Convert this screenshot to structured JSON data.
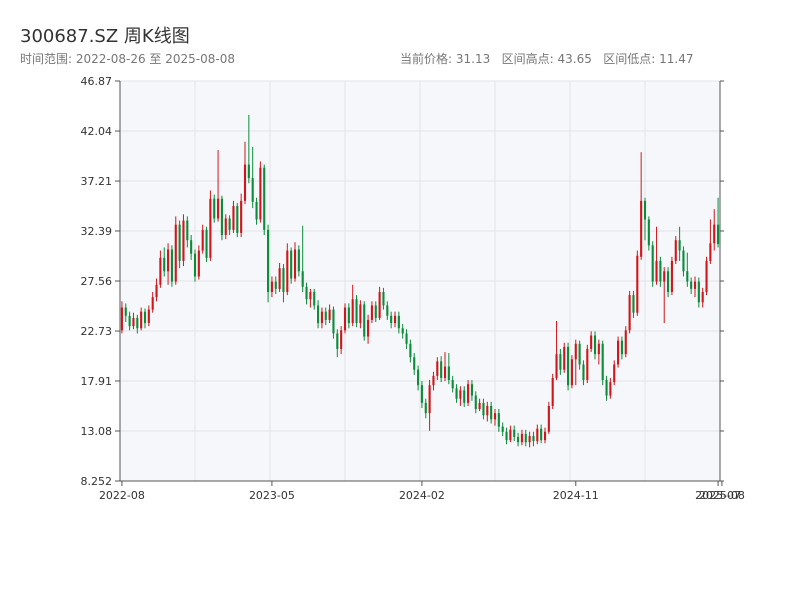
{
  "header": {
    "title": "300687.SZ 周K线图",
    "range_text": "时间范围: 2022-08-26 至 2025-08-08",
    "stats_text": "当前价格: 31.13   区间高点: 43.65   区间低点: 11.47"
  },
  "colors": {
    "up": "#d0161b",
    "down": "#0a8c39",
    "plot_bg": "#f6f7fa",
    "grid": "#e1e3e8",
    "axis": "#555555"
  },
  "chart_data": {
    "type": "candlestick",
    "title": "300687.SZ 周K线图",
    "xlabel": "",
    "ylabel": "",
    "ylim": [
      8.252,
      46.87
    ],
    "y_ticks": [
      "8.252",
      "13.08",
      "17.91",
      "22.73",
      "27.56",
      "32.39",
      "37.21",
      "42.04",
      "46.87"
    ],
    "x_ticks": [
      "2022-08",
      "2023-05",
      "2024-02",
      "2024-11",
      "2025-07",
      "2025-08"
    ],
    "x_tick_index": [
      0,
      39,
      78,
      118,
      155,
      156
    ],
    "grid": true,
    "candles": [
      [
        22.8,
        25.0,
        25.6,
        22.5
      ],
      [
        25.0,
        24.2,
        25.4,
        23.6
      ],
      [
        24.2,
        23.2,
        24.6,
        22.8
      ],
      [
        23.2,
        24.0,
        24.5,
        22.9
      ],
      [
        24.0,
        23.0,
        24.3,
        22.5
      ],
      [
        23.0,
        24.6,
        25.0,
        22.8
      ],
      [
        24.6,
        23.5,
        24.9,
        23.0
      ],
      [
        23.5,
        24.8,
        25.2,
        23.2
      ],
      [
        24.8,
        26.0,
        26.5,
        24.5
      ],
      [
        26.0,
        27.2,
        27.8,
        25.6
      ],
      [
        27.2,
        29.8,
        30.5,
        26.9
      ],
      [
        29.8,
        28.5,
        30.8,
        28.0
      ],
      [
        28.5,
        30.6,
        31.2,
        27.2
      ],
      [
        30.6,
        27.5,
        31.0,
        27.0
      ],
      [
        27.5,
        33.0,
        33.8,
        27.2
      ],
      [
        33.0,
        29.5,
        33.4,
        28.8
      ],
      [
        29.5,
        33.4,
        34.0,
        29.0
      ],
      [
        33.4,
        31.5,
        33.8,
        30.8
      ],
      [
        31.5,
        30.2,
        32.0,
        29.6
      ],
      [
        30.2,
        28.0,
        30.6,
        27.5
      ],
      [
        28.0,
        30.5,
        31.0,
        27.7
      ],
      [
        30.5,
        32.5,
        33.0,
        30.2
      ],
      [
        32.5,
        29.8,
        32.8,
        29.4
      ],
      [
        29.8,
        35.5,
        36.3,
        29.5
      ],
      [
        35.5,
        33.6,
        35.9,
        33.2
      ],
      [
        33.6,
        35.5,
        40.2,
        33.3
      ],
      [
        35.5,
        32.0,
        35.8,
        31.5
      ],
      [
        32.0,
        33.6,
        34.0,
        31.6
      ],
      [
        33.6,
        32.5,
        33.9,
        32.0
      ],
      [
        32.5,
        34.8,
        35.3,
        32.2
      ],
      [
        34.8,
        32.2,
        35.1,
        31.8
      ],
      [
        32.2,
        35.3,
        36.0,
        31.8
      ],
      [
        35.3,
        38.8,
        41.0,
        35.0
      ],
      [
        38.8,
        37.5,
        43.6,
        37.0
      ],
      [
        37.5,
        35.2,
        40.5,
        34.6
      ],
      [
        35.2,
        33.5,
        35.6,
        33.0
      ],
      [
        33.5,
        38.5,
        39.1,
        33.2
      ],
      [
        38.5,
        32.5,
        38.8,
        32.0
      ],
      [
        32.5,
        26.5,
        33.0,
        25.5
      ],
      [
        26.5,
        27.5,
        28.0,
        26.0
      ],
      [
        27.5,
        26.8,
        28.0,
        26.3
      ],
      [
        26.8,
        28.8,
        29.3,
        26.5
      ],
      [
        28.8,
        26.5,
        29.2,
        25.5
      ],
      [
        26.5,
        30.5,
        31.2,
        26.2
      ],
      [
        30.5,
        27.8,
        30.8,
        27.3
      ],
      [
        27.8,
        30.6,
        31.3,
        27.5
      ],
      [
        30.6,
        28.5,
        31.0,
        28.0
      ],
      [
        28.5,
        27.0,
        32.9,
        26.5
      ],
      [
        27.0,
        25.8,
        27.4,
        25.3
      ],
      [
        25.8,
        26.5,
        26.8,
        25.0
      ],
      [
        26.5,
        25.2,
        26.8,
        24.8
      ],
      [
        25.2,
        23.5,
        25.7,
        23.0
      ],
      [
        23.5,
        24.6,
        25.0,
        23.0
      ],
      [
        24.6,
        23.8,
        25.0,
        23.3
      ],
      [
        23.8,
        24.8,
        25.3,
        23.5
      ],
      [
        24.8,
        22.5,
        25.1,
        22.0
      ],
      [
        22.5,
        21.0,
        22.9,
        20.2
      ],
      [
        21.0,
        22.8,
        23.2,
        20.5
      ],
      [
        22.8,
        25.0,
        25.4,
        22.5
      ],
      [
        25.0,
        23.5,
        25.4,
        23.0
      ],
      [
        23.5,
        25.8,
        27.2,
        23.2
      ],
      [
        25.8,
        23.5,
        26.2,
        23.1
      ],
      [
        23.5,
        25.3,
        25.7,
        23.0
      ],
      [
        25.3,
        22.2,
        25.6,
        21.8
      ],
      [
        22.2,
        23.8,
        24.3,
        21.5
      ],
      [
        23.8,
        25.2,
        25.6,
        23.5
      ],
      [
        25.2,
        24.0,
        25.6,
        23.6
      ],
      [
        24.0,
        26.5,
        27.0,
        23.8
      ],
      [
        26.5,
        25.2,
        26.9,
        24.8
      ],
      [
        25.2,
        24.2,
        25.6,
        23.8
      ],
      [
        24.2,
        23.5,
        24.6,
        23.0
      ],
      [
        23.5,
        24.2,
        24.6,
        23.1
      ],
      [
        24.2,
        23.0,
        24.6,
        22.5
      ],
      [
        23.0,
        22.5,
        23.4,
        22.0
      ],
      [
        22.5,
        21.5,
        22.9,
        21.0
      ],
      [
        21.5,
        20.2,
        21.9,
        19.7
      ],
      [
        20.2,
        19.0,
        20.6,
        18.5
      ],
      [
        19.0,
        17.5,
        19.4,
        17.0
      ],
      [
        17.5,
        15.8,
        17.9,
        15.3
      ],
      [
        15.8,
        14.8,
        16.2,
        14.3
      ],
      [
        14.8,
        17.5,
        18.0,
        13.1
      ],
      [
        17.5,
        18.4,
        18.8,
        17.0
      ],
      [
        18.4,
        19.8,
        20.2,
        18.0
      ],
      [
        19.8,
        18.2,
        20.3,
        17.8
      ],
      [
        18.2,
        19.3,
        20.7,
        17.9
      ],
      [
        19.3,
        18.0,
        20.6,
        17.6
      ],
      [
        18.0,
        17.2,
        18.4,
        16.8
      ],
      [
        17.2,
        16.2,
        17.6,
        15.8
      ],
      [
        16.2,
        17.0,
        17.4,
        15.5
      ],
      [
        17.0,
        15.8,
        17.4,
        15.4
      ],
      [
        15.8,
        17.6,
        18.0,
        15.5
      ],
      [
        17.6,
        16.5,
        18.0,
        16.0
      ],
      [
        16.5,
        15.2,
        16.9,
        14.8
      ],
      [
        15.2,
        15.8,
        16.2,
        15.0
      ],
      [
        15.8,
        14.6,
        16.2,
        14.2
      ],
      [
        14.6,
        15.5,
        15.9,
        14.0
      ],
      [
        15.5,
        14.2,
        15.9,
        13.8
      ],
      [
        14.2,
        14.8,
        15.2,
        13.6
      ],
      [
        14.8,
        13.5,
        15.2,
        13.0
      ],
      [
        13.5,
        13.0,
        13.9,
        12.6
      ],
      [
        13.0,
        12.2,
        13.4,
        11.8
      ],
      [
        12.2,
        13.2,
        13.6,
        12.0
      ],
      [
        13.2,
        12.5,
        13.6,
        12.1
      ],
      [
        12.5,
        12.0,
        12.9,
        11.6
      ],
      [
        12.0,
        12.8,
        13.2,
        11.7
      ],
      [
        12.8,
        12.0,
        13.2,
        11.6
      ],
      [
        12.0,
        12.6,
        13.0,
        11.5
      ],
      [
        12.6,
        12.1,
        13.0,
        11.6
      ],
      [
        12.1,
        13.3,
        13.7,
        11.8
      ],
      [
        13.3,
        12.2,
        13.7,
        11.9
      ],
      [
        12.2,
        13.0,
        13.4,
        11.9
      ],
      [
        13.0,
        15.5,
        15.9,
        12.8
      ],
      [
        15.5,
        18.2,
        18.6,
        15.2
      ],
      [
        18.2,
        20.5,
        23.7,
        18.0
      ],
      [
        20.5,
        19.0,
        21.0,
        18.5
      ],
      [
        19.0,
        21.2,
        21.6,
        18.7
      ],
      [
        21.2,
        17.5,
        21.6,
        17.0
      ],
      [
        17.5,
        20.0,
        20.4,
        17.2
      ],
      [
        20.0,
        21.5,
        21.9,
        17.5
      ],
      [
        21.5,
        19.5,
        21.8,
        19.0
      ],
      [
        19.5,
        18.0,
        19.9,
        17.5
      ],
      [
        18.0,
        21.0,
        21.4,
        17.7
      ],
      [
        21.0,
        22.3,
        22.7,
        20.7
      ],
      [
        22.3,
        20.5,
        22.7,
        20.0
      ],
      [
        20.5,
        21.5,
        21.9,
        19.5
      ],
      [
        21.5,
        18.0,
        21.8,
        17.5
      ],
      [
        18.0,
        16.5,
        18.4,
        16.0
      ],
      [
        16.5,
        17.8,
        18.2,
        16.2
      ],
      [
        17.8,
        19.5,
        19.9,
        17.5
      ],
      [
        19.5,
        21.8,
        22.2,
        19.2
      ],
      [
        21.8,
        20.5,
        22.2,
        20.0
      ],
      [
        20.5,
        22.8,
        23.2,
        20.2
      ],
      [
        22.8,
        26.2,
        26.6,
        22.5
      ],
      [
        26.2,
        24.5,
        26.6,
        24.0
      ],
      [
        24.5,
        30.0,
        30.5,
        24.2
      ],
      [
        29.9,
        35.3,
        40.0,
        29.6
      ],
      [
        35.3,
        33.5,
        35.6,
        31.5
      ],
      [
        33.5,
        31.0,
        33.8,
        30.5
      ],
      [
        31.0,
        27.5,
        31.4,
        27.0
      ],
      [
        27.5,
        29.5,
        32.8,
        27.2
      ],
      [
        29.5,
        27.5,
        29.9,
        27.0
      ],
      [
        27.5,
        28.5,
        28.9,
        23.5
      ],
      [
        28.5,
        26.5,
        28.9,
        26.0
      ],
      [
        26.5,
        29.5,
        29.9,
        26.2
      ],
      [
        29.5,
        31.5,
        31.9,
        29.2
      ],
      [
        31.5,
        30.5,
        32.8,
        29.5
      ],
      [
        30.5,
        28.5,
        30.9,
        28.0
      ],
      [
        28.5,
        27.5,
        30.3,
        27.0
      ],
      [
        27.5,
        26.8,
        27.9,
        26.3
      ],
      [
        26.8,
        27.5,
        28.0,
        26.0
      ],
      [
        27.5,
        25.5,
        27.9,
        25.0
      ],
      [
        25.5,
        26.5,
        26.9,
        25.0
      ],
      [
        26.5,
        29.5,
        29.9,
        26.2
      ],
      [
        29.5,
        31.2,
        33.5,
        29.2
      ],
      [
        31.2,
        33.0,
        34.5,
        30.5
      ],
      [
        33.0,
        31.13,
        35.6,
        30.8
      ]
    ]
  }
}
